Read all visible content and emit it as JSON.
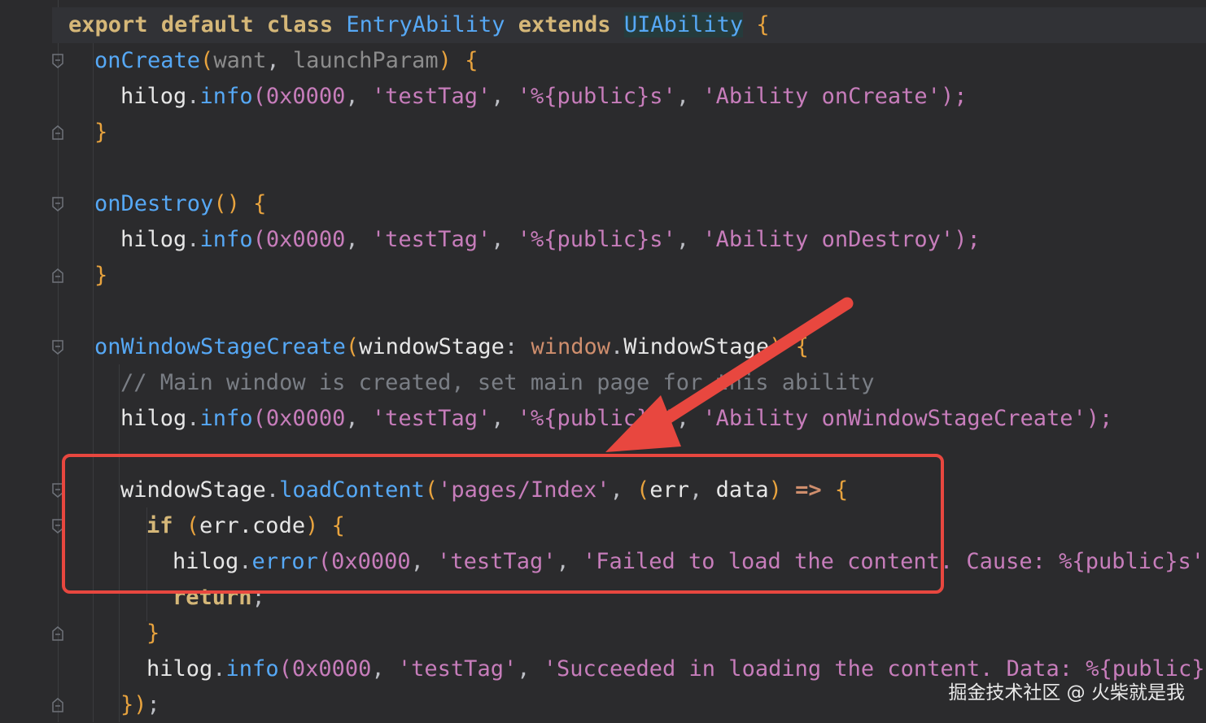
{
  "code": {
    "l1": {
      "export": "export",
      "default": "default",
      "class": "class",
      "name": "EntryAbility",
      "extends": "extends",
      "base": "UIAbility",
      "brace": "{"
    },
    "l2": {
      "fn": "onCreate",
      "open": "(",
      "p1": "want",
      "comma": ", ",
      "p2": "launchParam",
      "close": ")",
      "brace": " {"
    },
    "l3": {
      "obj": "hilog",
      "dot": ".",
      "m": "info",
      "open": "(",
      "num": "0x0000",
      "s1": "'testTag'",
      "s2": "'%{public}s'",
      "s3": "'Ability onCreate'",
      "end": ");"
    },
    "l4": {
      "brace": "}"
    },
    "l6": {
      "fn": "onDestroy",
      "parens": "()",
      "brace": " {"
    },
    "l7": {
      "obj": "hilog",
      "dot": ".",
      "m": "info",
      "open": "(",
      "num": "0x0000",
      "s1": "'testTag'",
      "s2": "'%{public}s'",
      "s3": "'Ability onDestroy'",
      "end": ");"
    },
    "l8": {
      "brace": "}"
    },
    "l10": {
      "fn": "onWindowStageCreate",
      "open": "(",
      "param": "windowStage",
      "colon": ": ",
      "ns": "window",
      "dot": ".",
      "type": "WindowStage",
      "close": ")",
      "brace": " {"
    },
    "l11": {
      "comment": "// Main window is created, set main page for this ability"
    },
    "l12": {
      "obj": "hilog",
      "dot": ".",
      "m": "info",
      "open": "(",
      "num": "0x0000",
      "s1": "'testTag'",
      "s2": "'%{public}s'",
      "s3": "'Ability onWindowStageCreate'",
      "end": ");"
    },
    "l14": {
      "obj": "windowStage",
      "dot": ".",
      "m": "loadContent",
      "open": "(",
      "s1": "'pages/Index'",
      "lp": "(",
      "a1": "err",
      "a2": "data",
      "rp": ")",
      "arrow": " => ",
      "brace": "{"
    },
    "l15": {
      "kw": "if",
      "open": " (",
      "expr": "err.code",
      "close": ")",
      "brace": " {"
    },
    "l16": {
      "obj": "hilog",
      "dot": ".",
      "m": "error",
      "open": "(",
      "num": "0x0000",
      "s1": "'testTag'",
      "s2": "'Failed to load the content. Cause: %{public}s'",
      "end": ","
    },
    "l17": {
      "kw": "return",
      "end": ";"
    },
    "l18": {
      "brace": "}"
    },
    "l19": {
      "obj": "hilog",
      "dot": ".",
      "m": "info",
      "open": "(",
      "num": "0x0000",
      "s1": "'testTag'",
      "s2": "'Succeeded in loading the content. Data: %{public}s"
    },
    "l20": {
      "close": "})",
      "end": ";"
    }
  },
  "comma": ", ",
  "watermark": "掘金技术社区 @ 火柴就是我",
  "colors": {
    "highlight_border": "#e8473f",
    "background": "#2b2b2d"
  }
}
